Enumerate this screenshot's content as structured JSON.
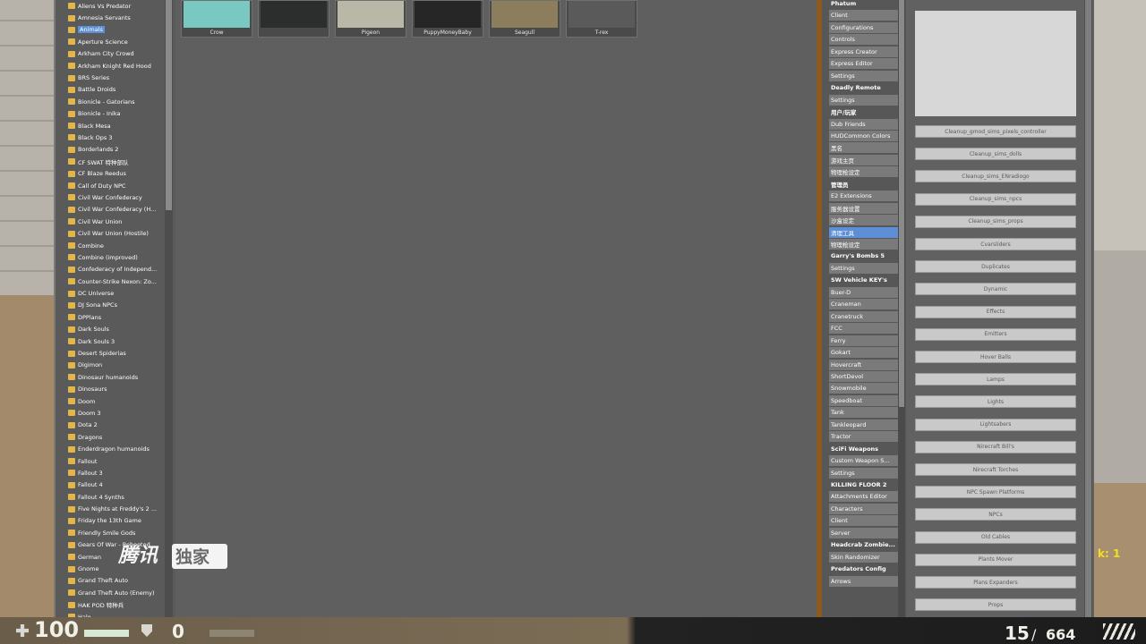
{
  "tree": {
    "items": [
      "Aliens Vs Predator",
      "Amnesia Servants",
      "Animals",
      "Aperture Science",
      "Arkham City Crowd",
      "Arkham Knight Red Hood",
      "BRS Series",
      "Battle Droids",
      "Bionicle - Gatorians",
      "Bionicle - Inika",
      "Black Mesa",
      "Black Ops 3",
      "Borderlands 2",
      "CF SWAT 特种部队",
      "CF Blaze Reedus",
      "Call of Duty NPC",
      "Civil War Confederacy",
      "Civil War Confederacy (H...",
      "Civil War Union",
      "Civil War Union (Hostile)",
      "Combine",
      "Combine (improved)",
      "Confederacy of Independ...",
      "Counter-Strike Nexon: Zo...",
      "DC Universe",
      "DJ Sona NPCs",
      "DPPlans",
      "Dark Souls",
      "Dark Souls 3",
      "Desert Spiderias",
      "Digimon",
      "Dinosaur humanoids",
      "Dinosaurs",
      "Doom",
      "Doom 3",
      "Dota 2",
      "Dragons",
      "Enderdragon humanoids",
      "Fallout",
      "Fallout 3",
      "Fallout 4",
      "Fallout 4 Synths",
      "Five Nights at Freddy's 2 ...",
      "Friday the 13th Game",
      "Friendly Smile Gods",
      "Gears Of War - Rebooted",
      "German",
      "Gnome",
      "Grand Theft Auto",
      "Grand Theft Auto (Enemy)",
      "HAK POD 特种兵",
      "Halo",
      "Halo 2"
    ],
    "selected_index": 2
  },
  "thumbnails": [
    {
      "label": "Crow",
      "color": "#79c9c2"
    },
    {
      "label": "",
      "color": "#2b2e2c"
    },
    {
      "label": "Pigeon",
      "color": "#b9b8a6"
    },
    {
      "label": "PuppyMoneyBaby",
      "color": "#262626"
    },
    {
      "label": "Seagull",
      "color": "#8c7e5c"
    },
    {
      "label": "T-rex",
      "color": "#5a5a5a"
    }
  ],
  "categories": [
    {
      "kind": "header",
      "label": "Phatum"
    },
    {
      "kind": "item",
      "label": "Client"
    },
    {
      "kind": "item",
      "label": "Configurations"
    },
    {
      "kind": "item",
      "label": "Controls"
    },
    {
      "kind": "item",
      "label": "Express Creator"
    },
    {
      "kind": "item",
      "label": "Express Editor"
    },
    {
      "kind": "item",
      "label": "Settings"
    },
    {
      "kind": "header",
      "label": "Deadly Remote"
    },
    {
      "kind": "item",
      "label": "Settings"
    },
    {
      "kind": "header",
      "label": "用户/玩家"
    },
    {
      "kind": "item",
      "label": "Dub Friends"
    },
    {
      "kind": "item",
      "label": "HUDCommon Colors"
    },
    {
      "kind": "item",
      "label": "黑名"
    },
    {
      "kind": "item",
      "label": "游戏主页"
    },
    {
      "kind": "item",
      "label": "物理枪设定"
    },
    {
      "kind": "header",
      "label": "管理员"
    },
    {
      "kind": "item",
      "label": "E2 Extensions"
    },
    {
      "kind": "item",
      "label": "服务器设置"
    },
    {
      "kind": "item",
      "label": "沙盒设定"
    },
    {
      "kind": "item",
      "label": "清理工具",
      "active": true
    },
    {
      "kind": "item",
      "label": "物理枪设定"
    },
    {
      "kind": "header",
      "label": "Garry's Bombs 5"
    },
    {
      "kind": "item",
      "label": "Settings"
    },
    {
      "kind": "header",
      "label": "SW Vehicle KEY's"
    },
    {
      "kind": "item",
      "label": "Buer-D"
    },
    {
      "kind": "item",
      "label": "Craneman"
    },
    {
      "kind": "item",
      "label": "Cranetruck"
    },
    {
      "kind": "item",
      "label": "FCC"
    },
    {
      "kind": "item",
      "label": "Ferry"
    },
    {
      "kind": "item",
      "label": "Gokart"
    },
    {
      "kind": "item",
      "label": "Hovercraft"
    },
    {
      "kind": "item",
      "label": "ShortDevol"
    },
    {
      "kind": "item",
      "label": "Snowmobile"
    },
    {
      "kind": "item",
      "label": "Speedboat"
    },
    {
      "kind": "item",
      "label": "Tank"
    },
    {
      "kind": "item",
      "label": "Tankleopard"
    },
    {
      "kind": "item",
      "label": "Tractor"
    },
    {
      "kind": "header",
      "label": "SciFi Weapons"
    },
    {
      "kind": "item",
      "label": "Custom Weapon S..."
    },
    {
      "kind": "item",
      "label": "Settings"
    },
    {
      "kind": "header",
      "label": "KILLING FLOOR 2"
    },
    {
      "kind": "item",
      "label": "Attachments Editor"
    },
    {
      "kind": "item",
      "label": "Characters"
    },
    {
      "kind": "item",
      "label": "Client"
    },
    {
      "kind": "item",
      "label": "Server"
    },
    {
      "kind": "header",
      "label": "Headcrab Zombie..."
    },
    {
      "kind": "item",
      "label": "Skin Randomizer"
    },
    {
      "kind": "header",
      "label": "Predators Config"
    },
    {
      "kind": "item",
      "label": "Arrows"
    }
  ],
  "tools": [
    "Cleanup_gmod_sims_pixels_controller",
    "Cleanup_sims_dolls",
    "Cleanup_sims_ENradiogo",
    "Cleanup_sims_npcs",
    "Cleanup_sims_props",
    "Cvarsliders",
    "Duplicates",
    "Dynamic",
    "Effects",
    "Emitters",
    "Hover Balls",
    "Lamps",
    "Lights",
    "Lightsabers",
    "Nirecraft Bill's",
    "Nirecraft Torches",
    "NPC Spawn Platforms",
    "NPCs",
    "Old Cables",
    "Plants Mover",
    "Plans Expanders",
    "Props"
  ],
  "hud": {
    "health": "100",
    "armor": "0",
    "clip": "15",
    "separator": "/",
    "reserve": "664",
    "kills": "k: 1"
  },
  "watermark": {
    "text": "腾讯",
    "badge": "独家"
  },
  "colors": {
    "selection": "#5e8fd6",
    "folder": "#e2b64a",
    "panel": "#5f5f5f",
    "hud_text": "#f0f0e8",
    "kill_text": "#f0e020"
  }
}
